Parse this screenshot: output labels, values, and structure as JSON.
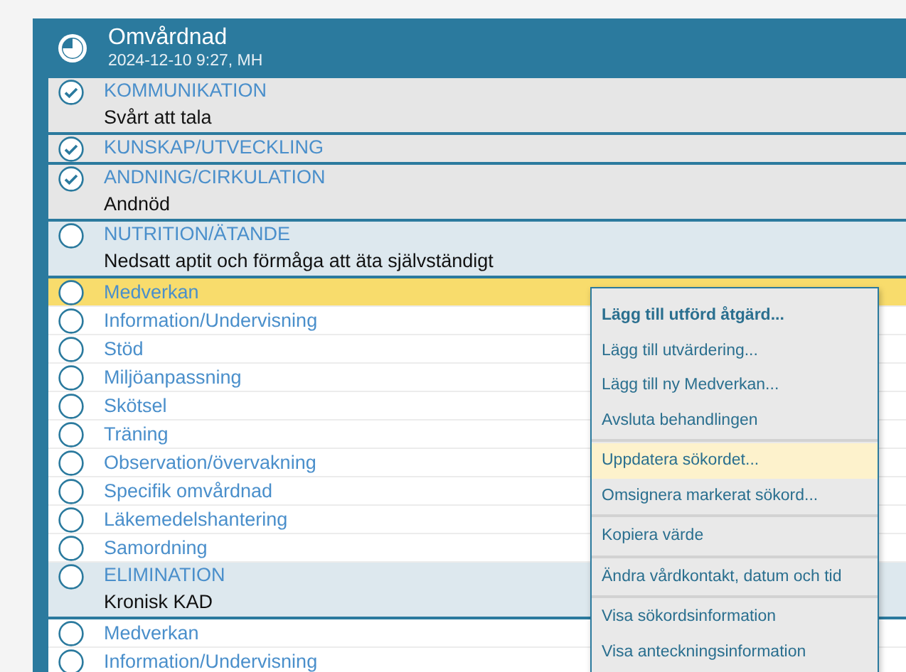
{
  "header": {
    "title": "Omvårdnad",
    "subtitle": "2024-12-10 9:27, MH"
  },
  "groups": [
    {
      "label": "KOMMUNIKATION",
      "note": "Svårt att tala",
      "checked": true
    },
    {
      "label": "KUNSKAP/UTVECKLING",
      "checked": true
    },
    {
      "label": "ANDNING/CIRKULATION",
      "note": "Andnöd",
      "checked": true
    },
    {
      "label": "NUTRITION/ÄTANDE",
      "note": "Nedsatt aptit och förmåga att äta självständigt",
      "checked": false,
      "children": [
        {
          "label": "Medverkan",
          "checked": false,
          "selected": true
        },
        {
          "label": "Information/Undervisning",
          "checked": false,
          "selected": false
        },
        {
          "label": "Stöd",
          "checked": false,
          "selected": false
        },
        {
          "label": "Miljöanpassning",
          "checked": false,
          "selected": false
        },
        {
          "label": "Skötsel",
          "checked": false,
          "selected": false
        },
        {
          "label": "Träning",
          "checked": false,
          "selected": false
        },
        {
          "label": "Observation/övervakning",
          "checked": false,
          "selected": false
        },
        {
          "label": "Specifik omvårdnad",
          "checked": false,
          "selected": false
        },
        {
          "label": "Läkemedelshantering",
          "checked": false,
          "selected": false
        },
        {
          "label": "Samordning",
          "checked": false,
          "selected": false
        }
      ]
    },
    {
      "label": "ELIMINATION",
      "note": "Kronisk KAD",
      "checked": false,
      "children": [
        {
          "label": "Medverkan",
          "checked": false,
          "selected": false
        },
        {
          "label": "Information/Undervisning",
          "checked": false,
          "selected": false
        }
      ]
    }
  ],
  "context_menu": {
    "sections": [
      {
        "items": [
          {
            "label": "Lägg till utförd åtgärd...",
            "kind": "default",
            "selected": false
          },
          {
            "label": "Lägg till utvärdering...",
            "kind": "normal",
            "selected": false
          },
          {
            "label": "Lägg till ny Medverkan...",
            "kind": "normal",
            "selected": false
          },
          {
            "label": "Avsluta behandlingen",
            "kind": "normal",
            "selected": false
          }
        ]
      },
      {
        "items": [
          {
            "label": "Uppdatera sökordet...",
            "kind": "normal",
            "selected": true
          },
          {
            "label": "Omsignera markerat sökord...",
            "kind": "normal",
            "selected": false
          }
        ]
      },
      {
        "items": [
          {
            "label": "Kopiera värde",
            "kind": "normal",
            "selected": false
          }
        ]
      },
      {
        "items": [
          {
            "label": "Ändra vårdkontakt, datum och tid",
            "kind": "normal",
            "selected": false
          }
        ]
      },
      {
        "items": [
          {
            "label": "Visa sökordsinformation",
            "kind": "normal",
            "selected": false
          },
          {
            "label": "Visa anteckningsinformation",
            "kind": "normal",
            "selected": false
          }
        ]
      }
    ]
  }
}
